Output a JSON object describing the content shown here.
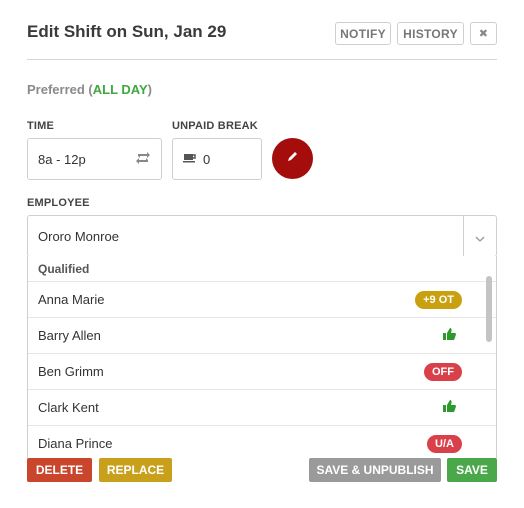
{
  "header": {
    "title": "Edit Shift on Sun, Jan 29",
    "notify_label": "NOTIFY",
    "history_label": "HISTORY",
    "close_label": "✖"
  },
  "preference": {
    "prefix": "Preferred (",
    "value": "ALL DAY",
    "suffix": ")"
  },
  "time": {
    "label": "TIME",
    "value": "8a - 12p"
  },
  "unpaid_break": {
    "label": "UNPAID BREAK",
    "value": "0"
  },
  "employee": {
    "label": "EMPLOYEE",
    "selected": "Ororo Monroe",
    "group_label": "Qualified",
    "options": [
      {
        "name": "Anna Marie",
        "badge": "+9 OT",
        "badge_color": "#c8a010",
        "icon": null
      },
      {
        "name": "Barry Allen",
        "badge": null,
        "badge_color": null,
        "icon": "thumbs-up-icon"
      },
      {
        "name": "Ben Grimm",
        "badge": "OFF",
        "badge_color": "#d9414a",
        "icon": null
      },
      {
        "name": "Clark Kent",
        "badge": null,
        "badge_color": null,
        "icon": "thumbs-up-icon"
      },
      {
        "name": "Diana Prince",
        "badge": "U/A",
        "badge_color": "#d9414a",
        "icon": null
      }
    ]
  },
  "footer": {
    "delete_label": "DELETE",
    "replace_label": "REPLACE",
    "save_unpublish_label": "SAVE & UNPUBLISH",
    "save_label": "SAVE"
  },
  "colors": {
    "delete": "#c9452c",
    "replace": "#c9a01b",
    "save_unpublish": "#9a9a9a",
    "save": "#4aa84a",
    "edit_button": "#a50d0d",
    "accent_green": "#3fa83f"
  }
}
